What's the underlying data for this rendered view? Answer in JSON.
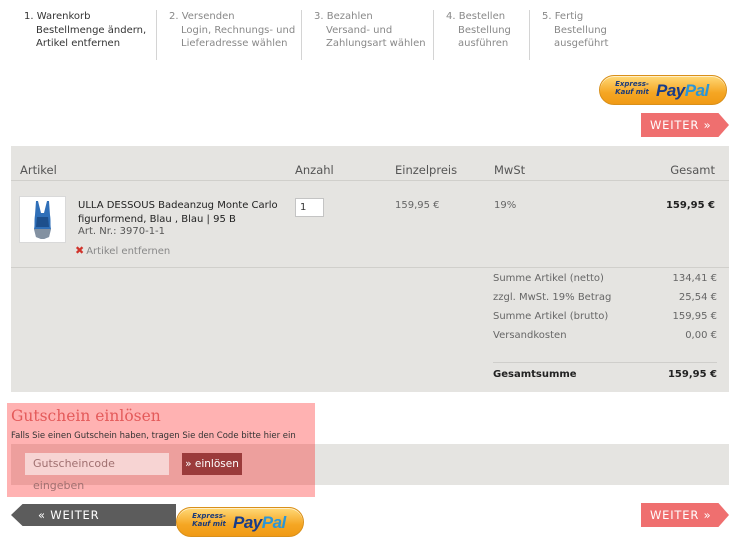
{
  "steps": [
    {
      "line1": "1. Warenkorb",
      "line2": "Bestellmenge ändern,",
      "line3": "Artikel entfernen"
    },
    {
      "line1": "2. Versenden",
      "line2": "Login, Rechnungs- und",
      "line3": "Lieferadresse wählen"
    },
    {
      "line1": "3. Bezahlen",
      "line2": "Versand- und",
      "line3": "Zahlungsart wählen"
    },
    {
      "line1": "4. Bestellen",
      "line2": "Bestellung",
      "line3": "ausführen"
    },
    {
      "line1": "5. Fertig",
      "line2": "Bestellung",
      "line3": "ausgeführt"
    }
  ],
  "paypal": {
    "express": "Express-Kauf mit",
    "pay": "Pay",
    "pal": "Pal"
  },
  "buttons": {
    "weiter": "WEITER »",
    "back": "« WEITER EINKAUFEN"
  },
  "cart": {
    "headers": {
      "artikel": "Artikel",
      "anzahl": "Anzahl",
      "einzelpreis": "Einzelpreis",
      "mwst": "MwSt",
      "gesamt": "Gesamt"
    },
    "item": {
      "name": "ULLA DESSOUS Badeanzug Monte Carlo figurformend, Blau , Blau | 95 B",
      "art_nr": "Art. Nr.: 3970-1-1",
      "remove": "Artikel entfernen",
      "qty": "1",
      "unit_price": "159,95 €",
      "vat": "19%",
      "total": "159,95 €"
    },
    "summary": [
      {
        "label": "Summe Artikel (netto)",
        "value": "134,41 €"
      },
      {
        "label": "zzgl. MwSt. 19% Betrag",
        "value": "25,54 €"
      },
      {
        "label": "Summe Artikel (brutto)",
        "value": "159,95 €"
      },
      {
        "label": "Versandkosten",
        "value": "0,00 €"
      }
    ],
    "grand_total": {
      "label": "Gesamtsumme",
      "value": "159,95 €"
    }
  },
  "voucher": {
    "title": "Gutschein einlösen",
    "hint": "Falls Sie einen Gutschein haben, tragen Sie den Code bitte hier ein",
    "placeholder": "Gutscheincode eingeben",
    "submit": "» einlösen"
  },
  "colors": {
    "accent": "#ef6f6f",
    "table_bg": "#e5e4e1",
    "voucher_title": "#e45a5a",
    "submit_bg": "#9b3b3b",
    "back_bg": "#5c5c5c"
  }
}
